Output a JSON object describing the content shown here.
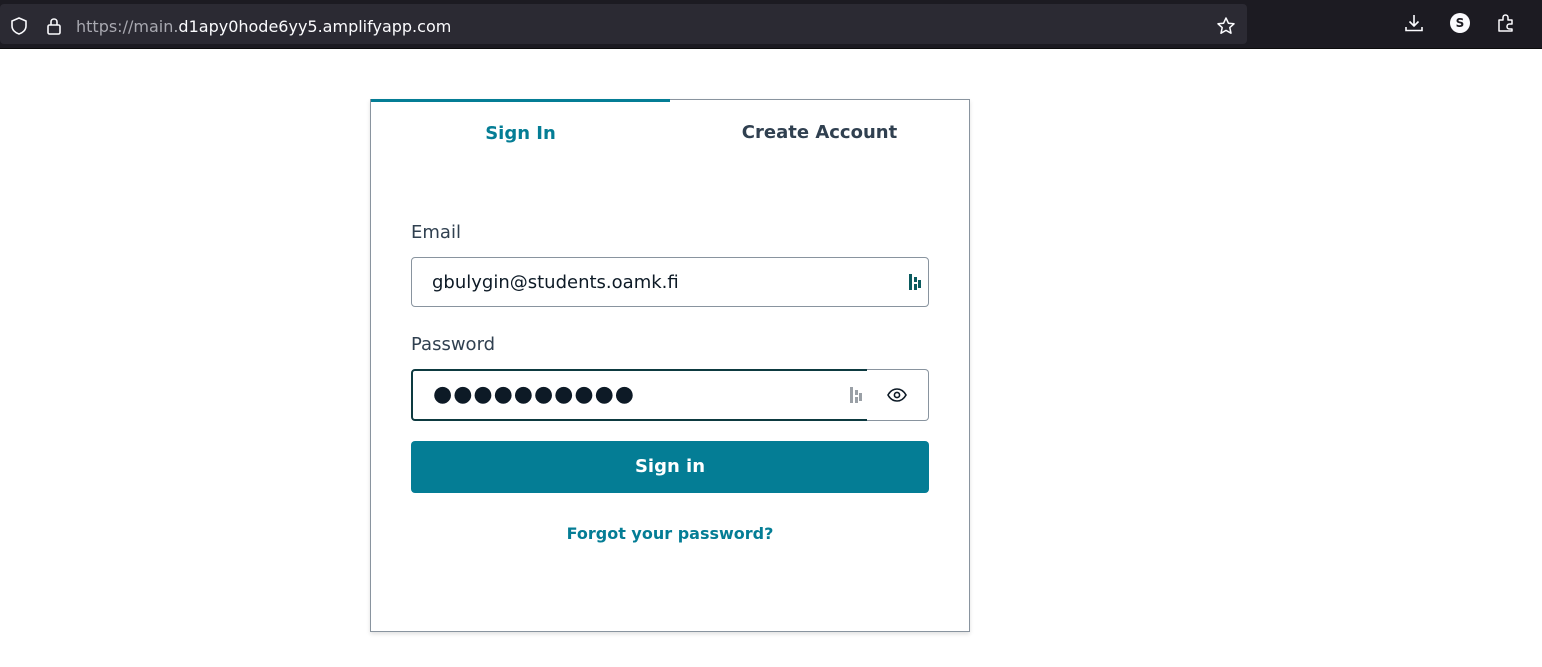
{
  "browser": {
    "url_prefix": "https://main.",
    "url_host": "d1apy0hode6yy5.amplifyapp.com",
    "profile_initial": "S",
    "icons": [
      "shield-icon",
      "lock-icon",
      "star-icon",
      "download-icon",
      "profile-icon",
      "extensions-icon"
    ]
  },
  "auth": {
    "tabs": [
      {
        "label": "Sign In",
        "active": true
      },
      {
        "label": "Create Account",
        "active": false
      }
    ],
    "email": {
      "label": "Email",
      "value": "gbulygin@students.oamk.fi"
    },
    "password": {
      "label": "Password",
      "value": "●●●●●●●●●●"
    },
    "submit_label": "Sign in",
    "forgot_label": "Forgot your password?"
  },
  "colors": {
    "accent": "#047d95",
    "chrome_bg": "#1c1b22",
    "urlbar_bg": "#2b2a33"
  }
}
